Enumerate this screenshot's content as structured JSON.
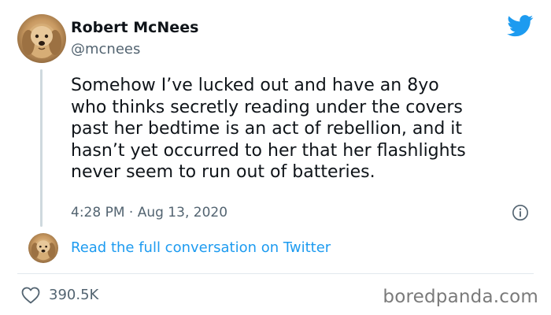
{
  "author": {
    "name": "Robert McNees",
    "handle": "@mcnees"
  },
  "tweet": {
    "lines": [
      "Somehow I’ve lucked out and have an 8yo",
      "who thinks secretly reading under the covers",
      "past her bedtime is an act of rebellion, and it",
      "hasn’t yet occurred to her that her flashlights",
      "never seem to run out of batteries."
    ],
    "timestamp": "4:28 PM · Aug 13, 2020"
  },
  "conversation_link": "Read the full conversation on Twitter",
  "likes": "390.5K",
  "watermark": "boredpanda.com",
  "icons": {
    "brand": "twitter-bird-icon",
    "info": "info-icon",
    "like": "heart-icon"
  },
  "colors": {
    "twitter_blue": "#1d9bf0",
    "text_primary": "#0f1419",
    "text_secondary": "#536471"
  }
}
